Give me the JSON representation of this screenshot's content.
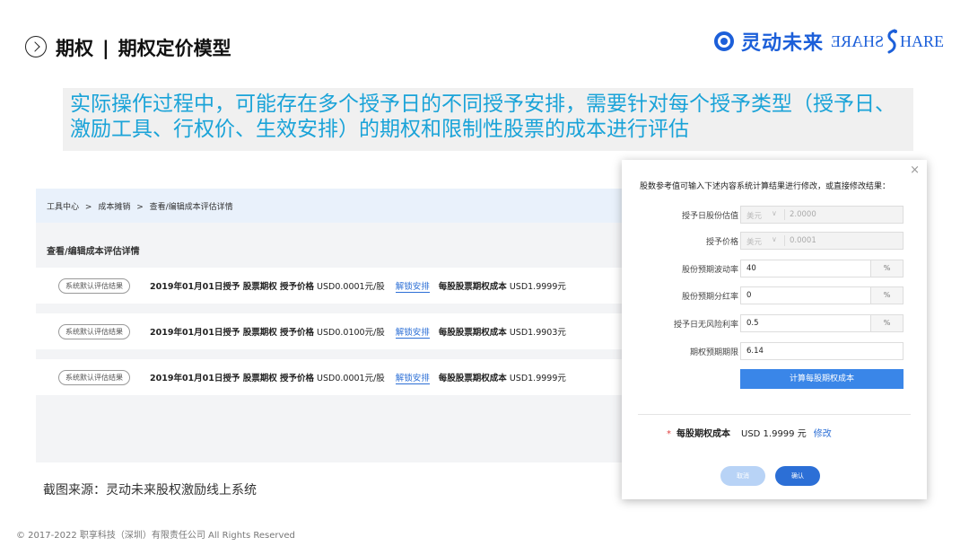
{
  "header": {
    "section": "期权",
    "separator": "|",
    "title": "期权定价模型"
  },
  "logo": {
    "cn": "灵动未来",
    "en_left": "SHARE",
    "en_right": "HARE",
    "brand_color": "#1c5fd9"
  },
  "statement": {
    "text": "实际操作过程中，可能存在多个授予日的不同授予安排，需要针对每个授予类型（授予日、激励工具、行权价、生效安排）的期权和限制性股票的成本进行评估",
    "color": "#1aa3d8"
  },
  "panel": {
    "breadcrumb": [
      "工具中心",
      ">",
      "成本摊销",
      ">",
      "查看/编辑成本评估详情"
    ],
    "section_title": "查看/编辑成本评估详情",
    "rows": [
      {
        "tag": "系统默认评估结果",
        "desc": "2019年01月01日授予 股票期权 授予价格",
        "price": "USD0.0001元/股",
        "unlock": "解锁安排",
        "cost_label": "每股股票期权成本",
        "cost": "USD1.9999元"
      },
      {
        "tag": "系统默认评估结果",
        "desc": "2019年01月01日授予 股票期权 授予价格",
        "price": "USD0.0100元/股",
        "unlock": "解锁安排",
        "cost_label": "每股股票期权成本",
        "cost": "USD1.9903元"
      },
      {
        "tag": "系统默认评估结果",
        "desc": "2019年01月01日授予 股票期权 授予价格",
        "price": "USD0.0001元/股",
        "unlock": "解锁安排",
        "cost_label": "每股股票期权成本",
        "cost": "USD1.9999元"
      }
    ]
  },
  "source": "截图来源：灵动未来股权激励线上系统",
  "footer": "© 2017-2022 职享科技（深圳）有限责任公司 All Rights Reserved",
  "modal": {
    "close": "×",
    "hint": "股数参考值可输入下述内容系统计算结果进行修改，或直接修改结果：",
    "fields": [
      {
        "label": "授予日股份估值",
        "currency": "美元",
        "value": "2.0000"
      },
      {
        "label": "授予价格",
        "currency": "美元",
        "value": "0.0001"
      },
      {
        "label": "股份预期波动率",
        "value": "40",
        "unit": "%"
      },
      {
        "label": "股份预期分红率",
        "value": "0",
        "unit": "%"
      },
      {
        "label": "授予日无风险利率",
        "value": "0.5",
        "unit": "%"
      },
      {
        "label": "期权预期期限",
        "value": "6.14"
      }
    ],
    "calc_button": "计算每股期权成本",
    "result_star": "*",
    "result_label": "每股期权成本",
    "result_value": "USD 1.9999 元",
    "edit": "修改",
    "cancel": "取消",
    "confirm": "确认"
  }
}
